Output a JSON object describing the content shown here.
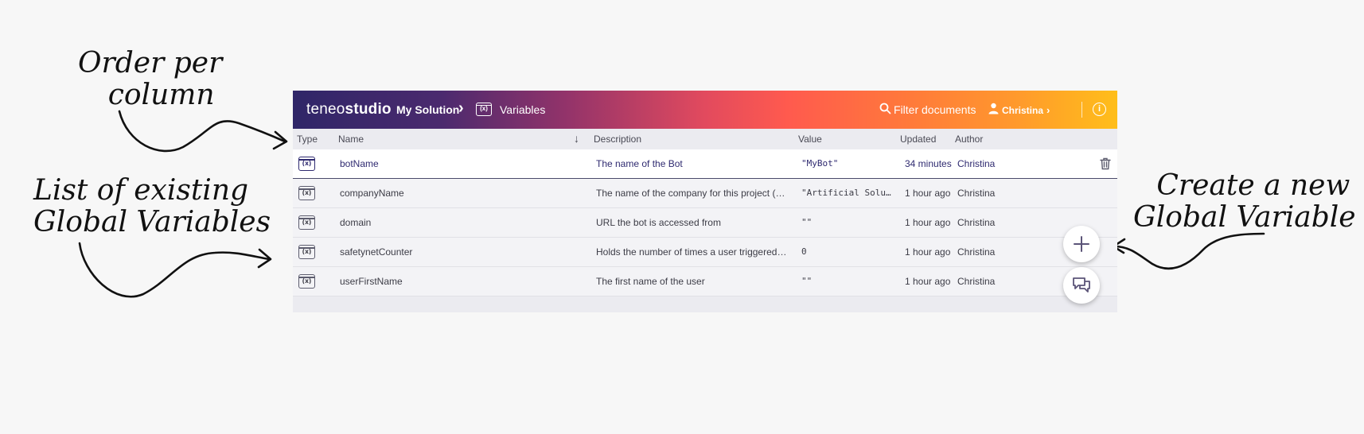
{
  "app": {
    "brand_light": "teneo",
    "brand_bold": "studio"
  },
  "breadcrumb": {
    "solution": "My Solution",
    "separator": "›",
    "page_icon": "(x)",
    "page": "Variables"
  },
  "header": {
    "filter_label": "Filter documents",
    "user_name": "Christina",
    "user_chevron": "›",
    "info_icon": "i"
  },
  "table": {
    "columns": {
      "type": "Type",
      "name": "Name",
      "sort_icon": "↓",
      "description": "Description",
      "value": "Value",
      "updated": "Updated",
      "author": "Author"
    },
    "icon_text": "(x)",
    "rows": [
      {
        "name": "botName",
        "description": "The name of the Bot",
        "value": "\"MyBot\"",
        "updated": "34 minutes",
        "author": "Christina"
      },
      {
        "name": "companyName",
        "description": "The name of the company for this project (adap...",
        "value": "\"Artificial Solut...",
        "updated": "1 hour ago",
        "author": "Christina"
      },
      {
        "name": "domain",
        "description": "URL the bot is accessed from",
        "value": "\"\"",
        "updated": "1 hour ago",
        "author": "Christina"
      },
      {
        "name": "safetynetCounter",
        "description": "Holds the number of times a user triggered the...",
        "value": "0",
        "updated": "1 hour ago",
        "author": "Christina"
      },
      {
        "name": "userFirstName",
        "description": "The first name of the user",
        "value": "\"\"",
        "updated": "1 hour ago",
        "author": "Christina"
      }
    ]
  },
  "annotations": {
    "order_line1": "Order per",
    "order_line2": "column",
    "list_line1": "List of existing",
    "list_line2": "Global Variables",
    "create_line1": "Create a new",
    "create_line2": "Global Variable"
  },
  "icons": [
    "search-icon",
    "user-icon",
    "info-icon",
    "variable-icon",
    "trash-icon",
    "plus-icon",
    "chat-icon",
    "sort-arrow-icon"
  ],
  "colors": {
    "accent_dark": "#2f2668",
    "accent_orange": "#ff7a3a",
    "accent_yellow": "#ffbe1a",
    "selected_text": "#2f2a70"
  }
}
